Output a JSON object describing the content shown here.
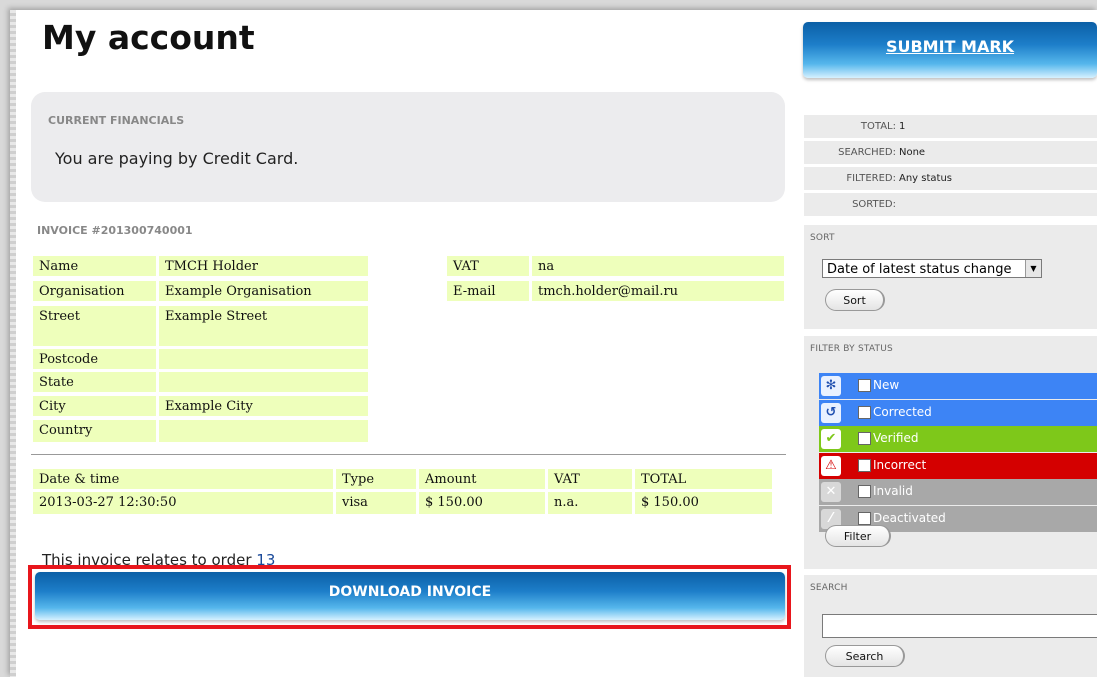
{
  "page": {
    "title": "My account"
  },
  "financials": {
    "label": "CURRENT FINANCIALS",
    "text": "You are paying by Credit Card."
  },
  "invoice": {
    "number": "INVOICE #201300740001",
    "holder": [
      {
        "label": "Name",
        "value": "TMCH Holder"
      },
      {
        "label": "Organisation",
        "value": "Example Organisation"
      },
      {
        "label": "Street",
        "value": "Example Street"
      },
      {
        "label": "Postcode",
        "value": ""
      },
      {
        "label": "State",
        "value": ""
      },
      {
        "label": "City",
        "value": "Example City"
      },
      {
        "label": "Country",
        "value": ""
      }
    ],
    "contact": [
      {
        "label": "VAT",
        "value": "na"
      },
      {
        "label": "E-mail",
        "value": "tmch.holder@mail.ru"
      }
    ],
    "payment": {
      "headers": [
        "Date & time",
        "Type",
        "Amount",
        "VAT",
        "TOTAL"
      ],
      "row": [
        "2013-03-27 12:30:50",
        "visa",
        "$ 150.00",
        "n.a.",
        "$ 150.00"
      ]
    },
    "relates_prefix": "This invoice relates to order ",
    "order_number": "13",
    "download_label": "DOWNLOAD INVOICE"
  },
  "sidebar": {
    "submit_label": "SUBMIT MARK",
    "summary": [
      {
        "label": "TOTAL:",
        "value": "1"
      },
      {
        "label": "SEARCHED:",
        "value": "None"
      },
      {
        "label": "FILTERED:",
        "value": "Any status"
      },
      {
        "label": "SORTED:",
        "value": ""
      }
    ],
    "sort": {
      "title": "SORT",
      "selected": "Date of latest status change",
      "button": "Sort"
    },
    "filter": {
      "title": "FILTER BY STATUS",
      "items": [
        {
          "label": "New",
          "color": "#3d84f5",
          "icon": "gear-icon"
        },
        {
          "label": "Corrected",
          "color": "#3d84f5",
          "icon": "refresh-icon"
        },
        {
          "label": "Verified",
          "color": "#7ec81a",
          "icon": "check-icon"
        },
        {
          "label": "Incorrect",
          "color": "#d40000",
          "icon": "warning-icon"
        },
        {
          "label": "Invalid",
          "color": "#a8a8a8",
          "icon": "x-icon"
        },
        {
          "label": "Deactivated",
          "color": "#a8a8a8",
          "icon": "slash-icon"
        }
      ],
      "button": "Filter"
    },
    "search": {
      "title": "SEARCH",
      "value": "",
      "button": "Search"
    }
  },
  "colors": {
    "accent_blue": "#1d7ec9",
    "highlight_red": "#e8161c",
    "table_bg": "#eeffbb"
  }
}
